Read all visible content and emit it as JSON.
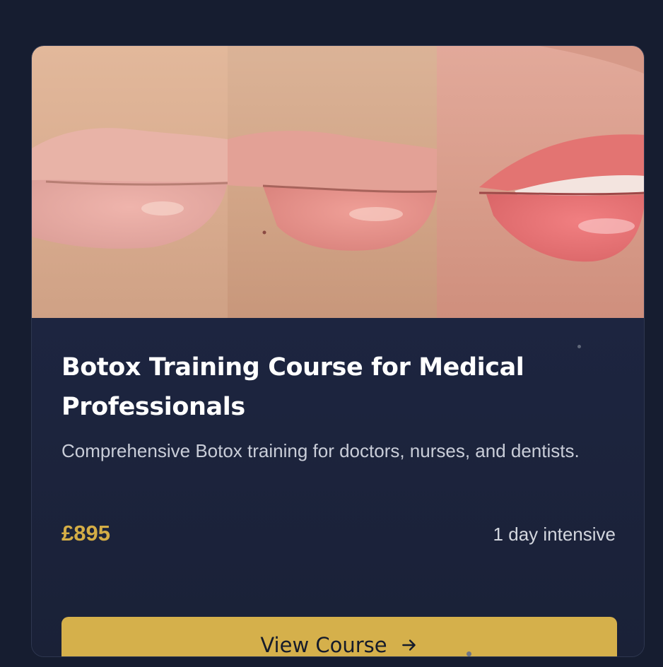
{
  "card": {
    "images": [
      {
        "icon": "lips-before-photo",
        "description_name": "before"
      },
      {
        "icon": "lips-after-photo",
        "description_name": "after-1"
      },
      {
        "icon": "lips-after-photo",
        "description_name": "after-2"
      }
    ],
    "title": "Botox Training Course for Medical Professionals",
    "description": "Comprehensive Botox training for doctors, nurses, and dentists.",
    "price": "£895",
    "duration": "1 day intensive",
    "cta_label": "View Course",
    "cta_icon": "arrow-right-icon"
  },
  "colors": {
    "page_background": "#161d30",
    "card_background": "#1b2238",
    "accent": "#d5b04b",
    "price": "#d4ad46",
    "title": "#ffffff",
    "description": "#c9cdd8"
  }
}
